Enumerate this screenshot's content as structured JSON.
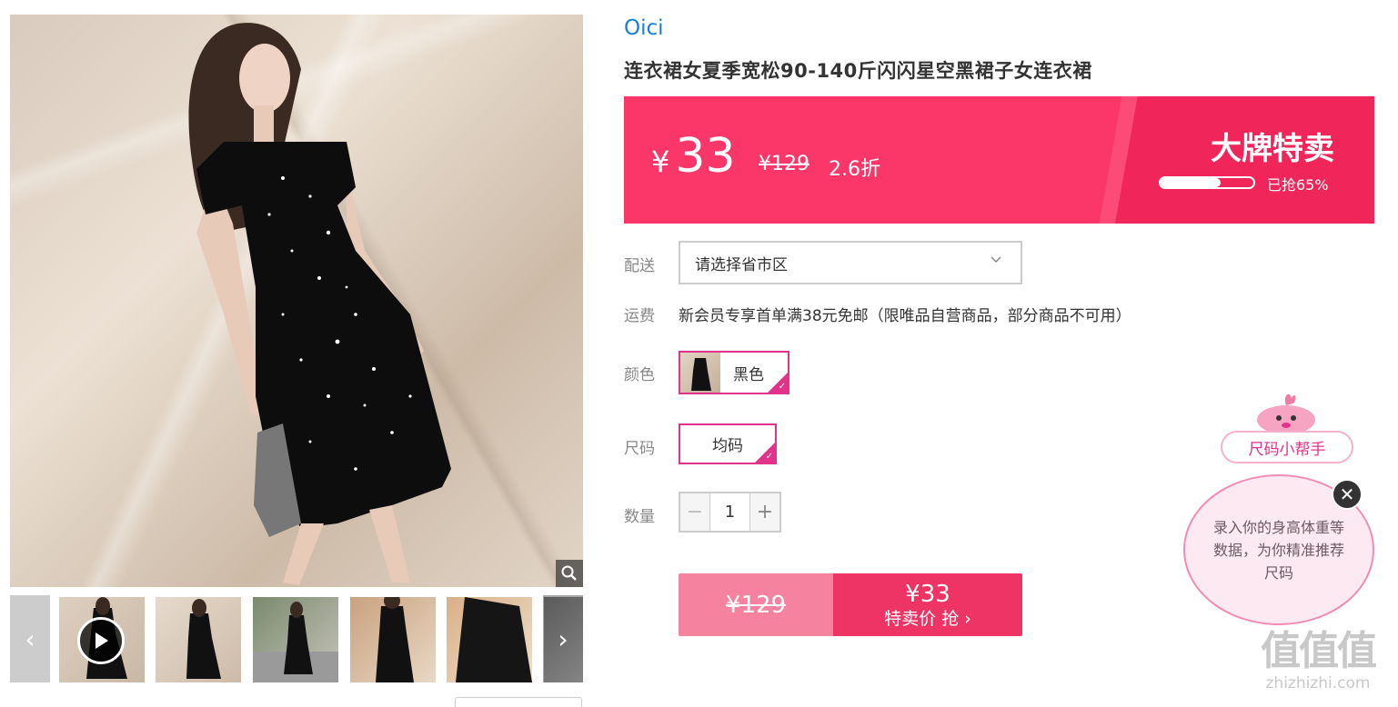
{
  "product": {
    "brand": "Oici",
    "title": "连衣裙女夏季宽松90-140斤闪闪星空黑裙子女连衣裙"
  },
  "price_banner": {
    "currency": "¥",
    "price": "33",
    "original_price": "¥129",
    "discount": "2.6折",
    "badge": "大牌特卖",
    "progress_label": "已抢65%",
    "progress_fraction": 0.65,
    "accent_color": "#fb3668"
  },
  "delivery": {
    "label": "配送",
    "placeholder": "请选择省市区"
  },
  "shipping": {
    "label": "运费",
    "text": "新会员专享首单满38元免邮（限唯品自营商品，部分商品不可用）"
  },
  "color": {
    "label": "颜色",
    "selected": "黑色"
  },
  "size": {
    "label": "尺码",
    "selected": "均码"
  },
  "quantity": {
    "label": "数量",
    "value": "1",
    "minus": "−",
    "plus": "+"
  },
  "buy": {
    "original_price": "¥129",
    "price": "¥33",
    "action": "特卖价 抢 ›"
  },
  "size_helper": {
    "title": "尺码小帮手",
    "message": "录入你的身高体重等数据，为你精准推荐尺码",
    "close": "✕"
  },
  "gallery": {
    "prev": "‹",
    "next": "›"
  },
  "watermark": {
    "logo": "值值值",
    "url": "zhizhizhi.com"
  }
}
